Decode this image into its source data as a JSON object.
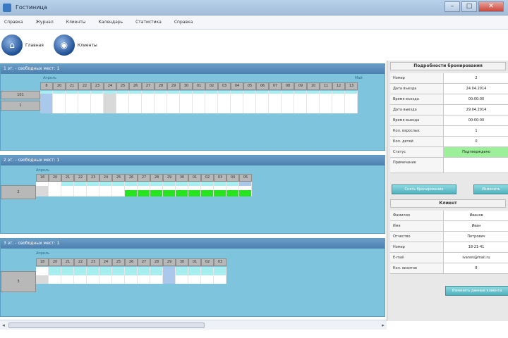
{
  "window": {
    "title": "Гостиница",
    "min": "–",
    "max": "□",
    "close": "✕"
  },
  "menu": [
    "Справка",
    "Журнал",
    "Клиенты",
    "Календарь",
    "Статистика",
    "Справка"
  ],
  "toolbar": {
    "buttons": [
      {
        "label": "Главная",
        "icon": "home-icon"
      },
      {
        "label": "Клиенты",
        "icon": "globe-icon"
      }
    ]
  },
  "sections": [
    {
      "title": "1 эт. - свободных мест: 1",
      "month": "Апрель",
      "month2": "Май",
      "days": [
        "8",
        "20",
        "21",
        "22",
        "23",
        "24",
        "25",
        "26",
        "27",
        "28",
        "29",
        "30",
        "01",
        "02",
        "03",
        "04",
        "05",
        "06",
        "07",
        "08",
        "09",
        "10",
        "11",
        "12",
        "13"
      ],
      "rooms": [
        "101",
        "1"
      ]
    },
    {
      "title": "2 эт. - свободных мест: 1",
      "month": "Апрель",
      "days": [
        "18",
        "20",
        "21",
        "22",
        "23",
        "24",
        "25",
        "26",
        "27",
        "28",
        "29",
        "30",
        "01",
        "02",
        "03",
        "04",
        "05"
      ],
      "rooms": [
        "2"
      ]
    },
    {
      "title": "3 эт. - свободных мест: 1",
      "month": "Апрель",
      "days": [
        "18",
        "20",
        "21",
        "22",
        "23",
        "24",
        "25",
        "26",
        "27",
        "28",
        "29",
        "30",
        "01",
        "02",
        "03"
      ],
      "rooms": [
        "3"
      ]
    }
  ],
  "booking": {
    "title": "Подробности бронирования",
    "rows": [
      {
        "label": "Номер",
        "value": "2"
      },
      {
        "label": "Дата въезда",
        "value": "24.04.2014"
      },
      {
        "label": "Время въезда",
        "value": "00:00:00"
      },
      {
        "label": "Дата выезда",
        "value": "29.04.2014"
      },
      {
        "label": "Время выезда",
        "value": "00:00:00"
      },
      {
        "label": "Кол. взрослых",
        "value": "1"
      },
      {
        "label": "Кол. детей",
        "value": "0"
      },
      {
        "label": "Статус",
        "value": "Подтверждено"
      },
      {
        "label": "Примечание",
        "value": ""
      }
    ],
    "btn_left": "Снять бронирование",
    "btn_right": "Изменить"
  },
  "client": {
    "title": "Клиент",
    "rows": [
      {
        "label": "Фамилия",
        "value": "Иванов"
      },
      {
        "label": "Имя",
        "value": "Иван"
      },
      {
        "label": "Отчество",
        "value": "Петрович"
      },
      {
        "label": "Номер",
        "value": "18-21-41"
      },
      {
        "label": "E-mail",
        "value": "ivanov@mail.ru"
      },
      {
        "label": "Кол. визитов",
        "value": "8"
      }
    ],
    "btn": "Изменить данные клиента"
  },
  "colors": {
    "accent": "#7ec4dd",
    "header": "#4d80b0",
    "green": "#26e51f",
    "status": "#9cf09a"
  }
}
